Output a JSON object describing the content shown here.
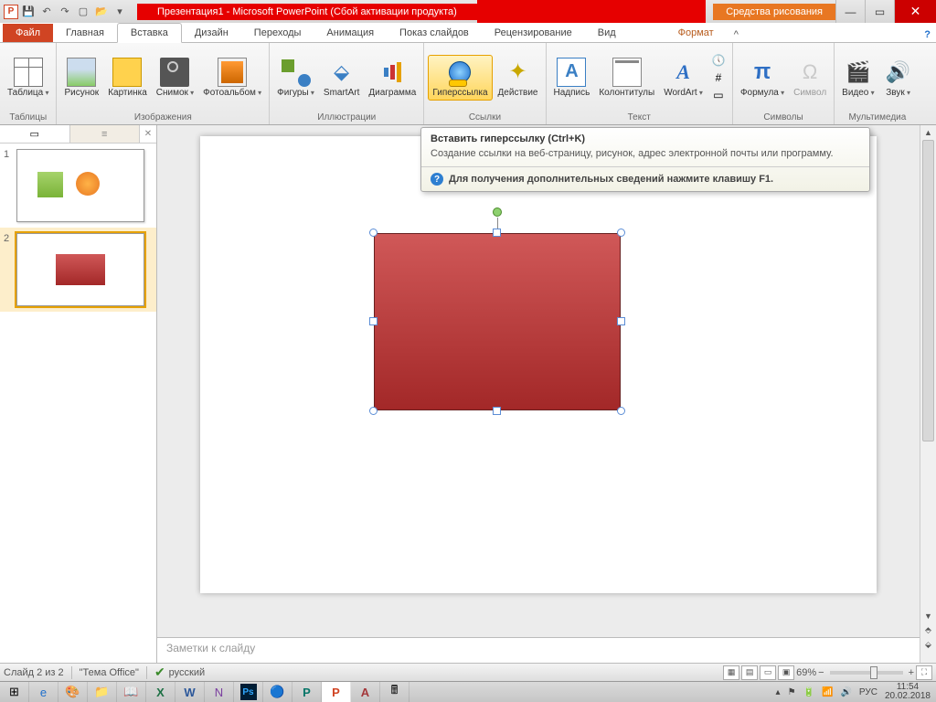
{
  "titlebar": {
    "app_title": "Презентация1 - Microsoft PowerPoint (Сбой активации продукта)",
    "tool_context": "Средства рисования"
  },
  "tabs": {
    "file": "Файл",
    "items": [
      "Главная",
      "Вставка",
      "Дизайн",
      "Переходы",
      "Анимация",
      "Показ слайдов",
      "Рецензирование",
      "Вид"
    ],
    "format": "Формат"
  },
  "ribbon": {
    "tables": {
      "label": "Таблицы",
      "table": "Таблица"
    },
    "images": {
      "label": "Изображения",
      "picture": "Рисунок",
      "clipart": "Картинка",
      "screenshot": "Снимок",
      "album": "Фотоальбом"
    },
    "illus": {
      "label": "Иллюстрации",
      "shapes": "Фигуры",
      "smartart": "SmartArt",
      "chart": "Диаграмма"
    },
    "links": {
      "label": "Ссылки",
      "hyperlink": "Гиперссылка",
      "action": "Действие"
    },
    "text": {
      "label": "Текст",
      "textbox": "Надпись",
      "headerfooter": "Колонтитулы",
      "wordart": "WordArt"
    },
    "symbols": {
      "label": "Символы",
      "equation": "Формула",
      "symbol": "Символ"
    },
    "media": {
      "label": "Мультимедиа",
      "video": "Видео",
      "audio": "Звук"
    }
  },
  "tooltip": {
    "title": "Вставить гиперссылку (Ctrl+K)",
    "body": "Создание ссылки на веб-страницу, рисунок, адрес электронной почты или программу.",
    "help": "Для получения дополнительных сведений нажмите клавишу F1."
  },
  "notes_placeholder": "Заметки к слайду",
  "status": {
    "slide_info": "Слайд 2 из 2",
    "theme": "\"Тema Office\"",
    "theme_txt": "\"Тема Office\"",
    "language": "русский",
    "zoom": "69%"
  },
  "tray": {
    "lang": "РУС",
    "time": "11:54",
    "date": "20.02.2018"
  },
  "slides": [
    "1",
    "2"
  ]
}
